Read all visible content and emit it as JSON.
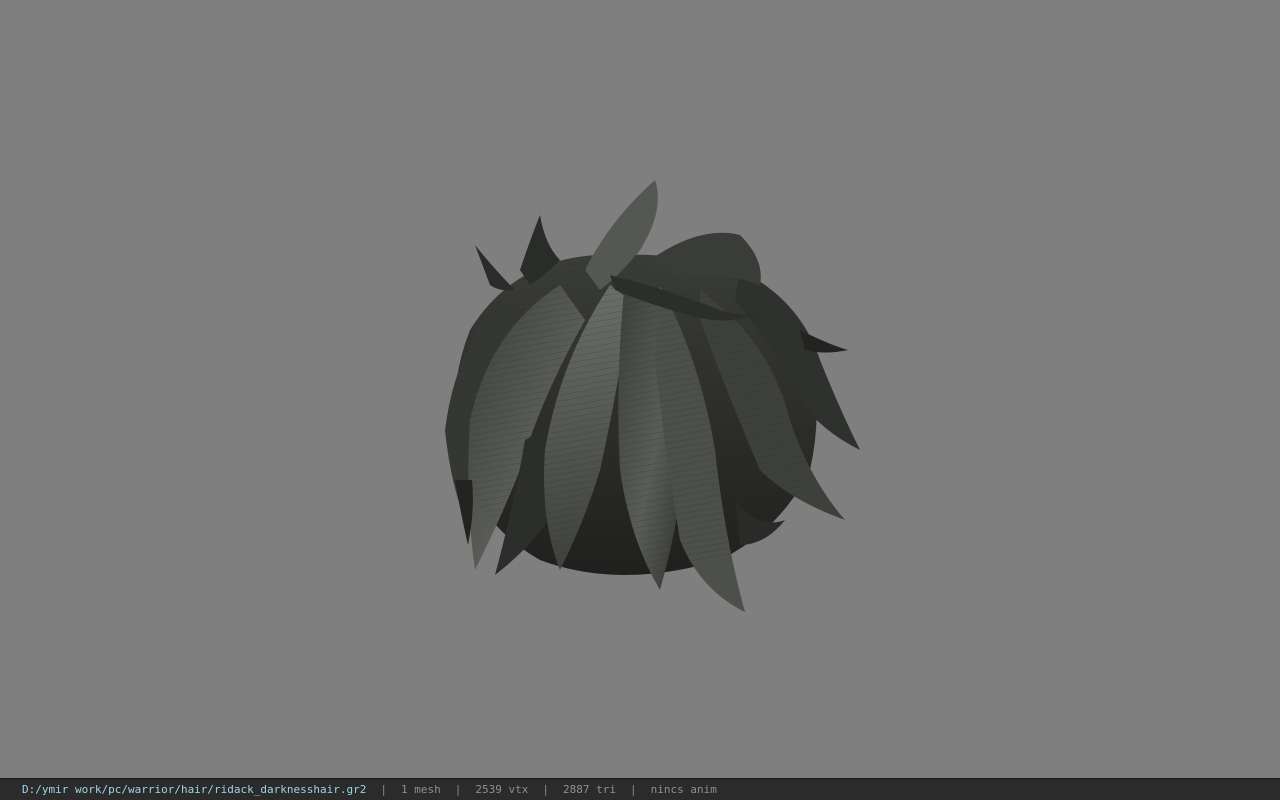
{
  "viewport": {
    "background": "#7f7f7f",
    "model": "hair-mesh"
  },
  "status_bar": {
    "path": "D:/ymir work/pc/warrior/hair/ridack_darknesshair.gr2",
    "separator": "|",
    "mesh_count": "1 mesh",
    "vertex_count": "2539 vtx",
    "triangle_count": "2887 tri",
    "anim_status": "nincs anim"
  },
  "colors": {
    "hair_dark": "#2f312e",
    "hair_mid": "#4a4c48",
    "hair_light": "#6a6c67",
    "status_path": "#9fd3e6"
  }
}
